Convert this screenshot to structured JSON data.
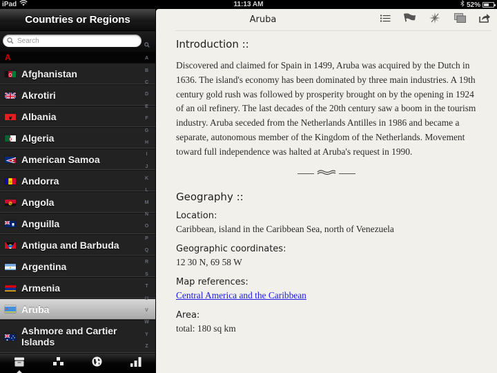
{
  "status_bar": {
    "device": "iPad",
    "wifi_icon": "wifi-icon",
    "time": "11:13 AM",
    "bluetooth_icon": "bluetooth-icon",
    "battery_percent_label": "52%",
    "battery_level": 0.52
  },
  "sidebar": {
    "title": "Countries or Regions",
    "search": {
      "placeholder": "Search",
      "value": ""
    },
    "section_letter": "A",
    "countries": [
      {
        "name": "Afghanistan",
        "flag": "flag-afghanistan",
        "selected": false
      },
      {
        "name": "Akrotiri",
        "flag": "flag-akrotiri",
        "selected": false
      },
      {
        "name": "Albania",
        "flag": "flag-albania",
        "selected": false
      },
      {
        "name": "Algeria",
        "flag": "flag-algeria",
        "selected": false
      },
      {
        "name": "American Samoa",
        "flag": "flag-american-samoa",
        "selected": false
      },
      {
        "name": "Andorra",
        "flag": "flag-andorra",
        "selected": false
      },
      {
        "name": "Angola",
        "flag": "flag-angola",
        "selected": false
      },
      {
        "name": "Anguilla",
        "flag": "flag-anguilla",
        "selected": false
      },
      {
        "name": "Antigua and Barbuda",
        "flag": "flag-antigua-and-barbuda",
        "selected": false
      },
      {
        "name": "Argentina",
        "flag": "flag-argentina",
        "selected": false
      },
      {
        "name": "Armenia",
        "flag": "flag-armenia",
        "selected": false
      },
      {
        "name": "Aruba",
        "flag": "flag-aruba",
        "selected": true
      },
      {
        "name": "Ashmore and Cartier Islands",
        "flag": "flag-ashmore-and-cartier-islands",
        "selected": false
      }
    ],
    "index_letters": [
      "🔍",
      "A",
      "B",
      "C",
      "D",
      "E",
      "F",
      "G",
      "H",
      "I",
      "J",
      "K",
      "L",
      "M",
      "N",
      "O",
      "P",
      "Q",
      "R",
      "S",
      "T",
      "U",
      "V",
      "W",
      "Y",
      "Z"
    ],
    "tabs": [
      {
        "name": "countries-tab",
        "icon": "archive-box-icon",
        "active": true
      },
      {
        "name": "regions-tab",
        "icon": "hierarchy-icon",
        "active": false
      },
      {
        "name": "map-tab",
        "icon": "globe-icon",
        "active": false
      },
      {
        "name": "rankings-tab",
        "icon": "bar-chart-icon",
        "active": false
      }
    ]
  },
  "detail": {
    "title": "Aruba",
    "toolbar": [
      {
        "name": "contents-button",
        "icon": "list-icon"
      },
      {
        "name": "flag-button",
        "icon": "flag-icon"
      },
      {
        "name": "compass-button",
        "icon": "compass-icon"
      },
      {
        "name": "gallery-button",
        "icon": "photos-icon"
      },
      {
        "name": "share-button",
        "icon": "share-icon"
      }
    ],
    "introduction": {
      "heading": "Introduction ::",
      "text": "Discovered and claimed for Spain in 1499, Aruba was acquired by the Dutch in 1636. The island's economy has been dominated by three main industries. A 19th century gold rush was followed by prosperity brought on by the opening in 1924 of an oil refinery. The last decades of the 20th century saw a boom in the tourism industry. Aruba seceded from the Netherlands Antilles in 1986 and became a separate, autonomous member of the Kingdom of the Netherlands. Movement toward full independence was halted at Aruba's request in 1990."
    },
    "divider_glyph": "≈",
    "geography": {
      "heading": "Geography ::",
      "location_label": "Location",
      "location_value": "Caribbean, island in the Caribbean Sea, north of Venezuela",
      "coordinates_label": "Geographic coordinates",
      "coordinates_value": "12 30 N, 69 58 W",
      "map_label": "Map references",
      "map_link": "Central America and the Caribbean",
      "area_label": "Area",
      "area_value": "total: 180 sq km",
      "label_suffix": ":"
    }
  }
}
